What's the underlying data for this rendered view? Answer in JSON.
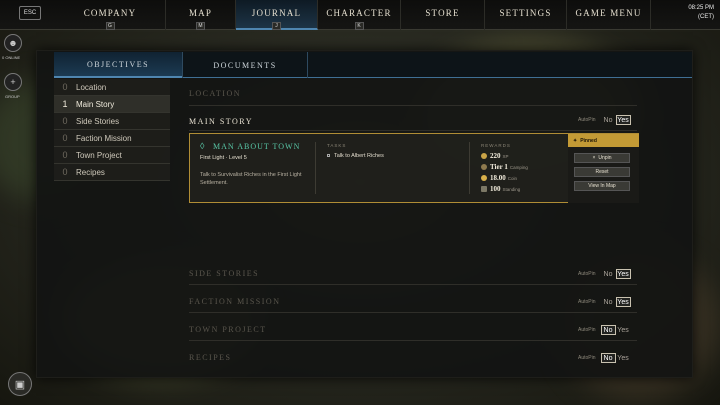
{
  "topnav": {
    "esc_label": "ESC",
    "tabs": [
      {
        "label": "COMPANY",
        "key": "G"
      },
      {
        "label": "MAP",
        "key": "M"
      },
      {
        "label": "JOURNAL",
        "key": "J"
      },
      {
        "label": "CHARACTER",
        "key": "K"
      },
      {
        "label": "STORE",
        "key": ""
      },
      {
        "label": "SETTINGS",
        "key": ""
      },
      {
        "label": "GAME MENU",
        "key": ""
      }
    ],
    "active_tab": "JOURNAL",
    "clock_time": "08:25 PM",
    "clock_zone": "(CET)"
  },
  "side": {
    "online_label": "0 ONLINE",
    "group_label": "GROUP"
  },
  "journal": {
    "tabs": [
      "OBJECTIVES",
      "DOCUMENTS"
    ],
    "active_tab": "OBJECTIVES",
    "categories": [
      {
        "count": "0",
        "label": "Location"
      },
      {
        "count": "1",
        "label": "Main Story"
      },
      {
        "count": "0",
        "label": "Side Stories"
      },
      {
        "count": "0",
        "label": "Faction Mission"
      },
      {
        "count": "0",
        "label": "Town Project"
      },
      {
        "count": "0",
        "label": "Recipes"
      }
    ],
    "active_category": "Main Story",
    "sections": {
      "location": "LOCATION",
      "main_story": "MAIN STORY",
      "side_stories": "SIDE STORIES",
      "faction_mission": "FACTION MISSION",
      "town_project": "TOWN PROJECT",
      "recipes": "RECIPES"
    },
    "autopin": {
      "label": "AutoPin",
      "no": "No",
      "yes": "Yes"
    },
    "autopin_values": {
      "main_story": "Yes",
      "side_stories": "Yes",
      "faction_mission": "Yes",
      "town_project": "No",
      "recipes": "No"
    }
  },
  "quest": {
    "title": "MAN ABOUT TOWN",
    "subtitle": "First Light · Level 5",
    "description": "Talk to Survivalist Riches in the First Light Settlement.",
    "tasks_header": "TASKS",
    "task": "Talk to Albert Riches",
    "rewards_header": "REWARDS",
    "rewards": [
      {
        "value": "220",
        "label": "XP"
      },
      {
        "value": "Tier 1",
        "label": "Camping"
      },
      {
        "value": "18.00",
        "label": "Coin"
      },
      {
        "value": "100",
        "label": "Standing"
      }
    ],
    "pinned_label": "Pinned",
    "unpin_label": "Unpin",
    "reset_label": "Reset",
    "view_map_label": "View In Map"
  },
  "colors": {
    "accent_blue": "#4f86b0",
    "gold": "#c39a35",
    "quest_green": "#58c6a6"
  }
}
